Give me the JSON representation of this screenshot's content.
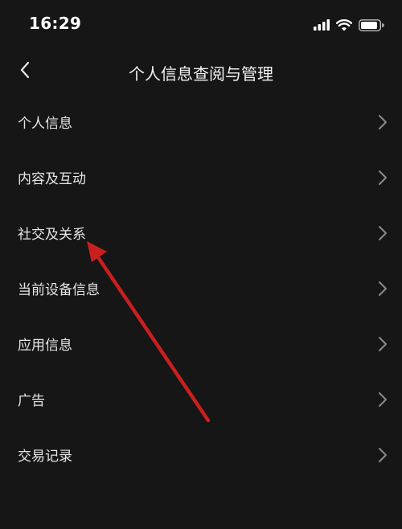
{
  "status_bar": {
    "time": "16:29",
    "icons": [
      "signal-icon",
      "wifi-icon",
      "battery-icon"
    ]
  },
  "nav": {
    "title": "个人信息查阅与管理",
    "back_icon": "chevron-left-icon"
  },
  "menu": [
    {
      "label": "个人信息"
    },
    {
      "label": "内容及互动"
    },
    {
      "label": "社交及关系"
    },
    {
      "label": "当前设备信息"
    },
    {
      "label": "应用信息"
    },
    {
      "label": "广告"
    },
    {
      "label": "交易记录"
    }
  ],
  "annotation": {
    "type": "arrow",
    "color": "#c8201f",
    "points_to": "社交及关系"
  },
  "colors": {
    "background": "#161616",
    "text": "#e6e6e6",
    "chevron": "#8a8a8a"
  }
}
